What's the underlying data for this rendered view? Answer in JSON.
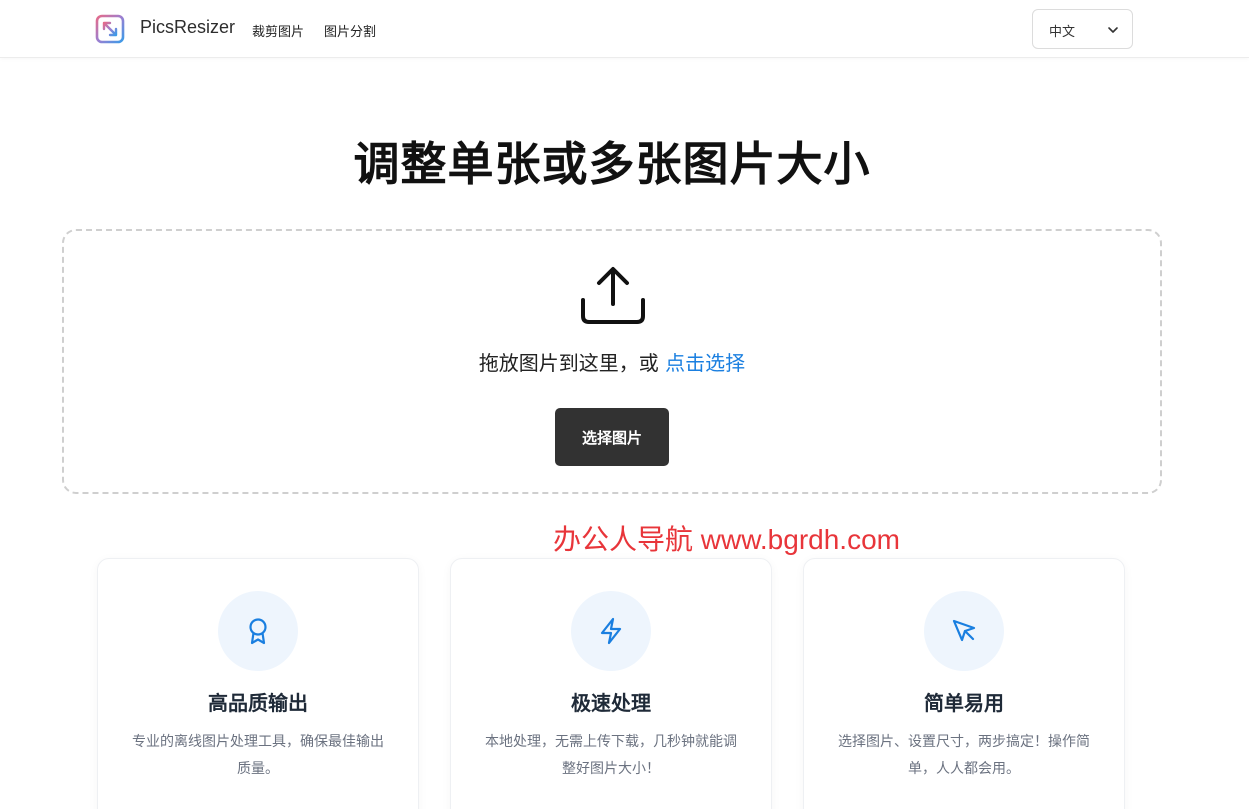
{
  "header": {
    "brand": "PicsResizer",
    "nav": [
      {
        "label": "裁剪图片"
      },
      {
        "label": "图片分割"
      }
    ],
    "language": "中文"
  },
  "main": {
    "title": "调整单张或多张图片大小",
    "dropzone": {
      "text": "拖放图片到这里，或",
      "link": "点击选择",
      "button": "选择图片"
    }
  },
  "watermark": "办公人导航  www.bgrdh.com",
  "features": [
    {
      "icon": "award-icon",
      "title": "高品质输出",
      "desc": "专业的离线图片处理工具，确保最佳输出质量。"
    },
    {
      "icon": "lightning-icon",
      "title": "极速处理",
      "desc": "本地处理，无需上传下载，几秒钟就能调整好图片大小！"
    },
    {
      "icon": "cursor-icon",
      "title": "简单易用",
      "desc": "选择图片、设置尺寸，两步搞定！操作简单，人人都会用。"
    }
  ],
  "colors": {
    "accent": "#1a7fe0",
    "button": "#323232",
    "watermark": "#e8353a"
  }
}
